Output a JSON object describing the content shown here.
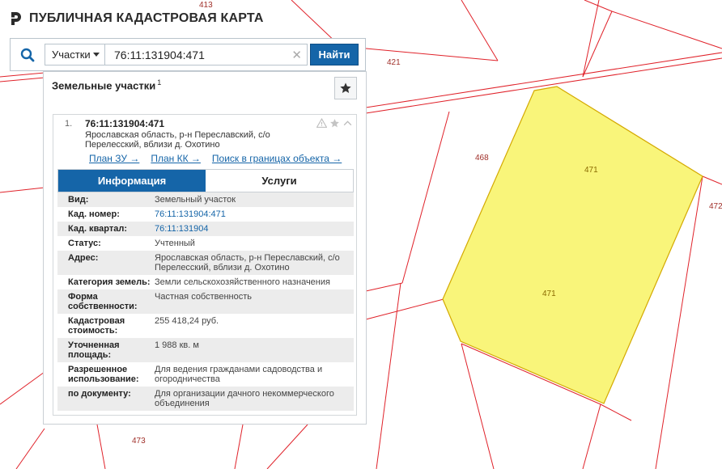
{
  "app": {
    "title": "ПУБЛИЧНАЯ КАДАСТРОВАЯ КАРТА",
    "logo_icon": "pkk-logo-icon"
  },
  "search": {
    "icon": "search-icon",
    "type_selected": "Участки",
    "query": "76:11:131904:471",
    "clear_symbol": "✕",
    "find_label": "Найти"
  },
  "map": {
    "labels": {
      "l413": "413",
      "l421": "421",
      "l468": "468",
      "l472": "472",
      "l473": "473"
    },
    "parcel_labels": {
      "p1": "471",
      "p2": "471"
    },
    "parcel_fill": "#f9f57a",
    "parcel_stroke": "#d4a900",
    "boundary_color": "#e0222a"
  },
  "panel": {
    "heading": "Земельные участки",
    "count": "1",
    "favorite_icon": "star-icon",
    "result": {
      "index": "1.",
      "cad_number": "76:11:131904:471",
      "address": "Ярославская область, р-н Переславский, с/о Перелесский, вблизи д. Охотино",
      "links": [
        "План ЗУ →",
        "План КК →",
        "Поиск в границах объекта →"
      ],
      "tabs": {
        "info": "Информация",
        "services": "Услуги"
      },
      "attributes": [
        {
          "key": "Вид:",
          "value": "Земельный участок"
        },
        {
          "key": "Кад. номер:",
          "value": "76:11:131904:471",
          "link": true
        },
        {
          "key": "Кад. квартал:",
          "value": "76:11:131904",
          "link": true
        },
        {
          "key": "Статус:",
          "value": "Учтенный"
        },
        {
          "key": "Адрес:",
          "value": "Ярославская область, р-н Переславский, с/о Перелесский, вблизи д. Охотино"
        },
        {
          "key": "Категория земель:",
          "value": "Земли сельскохозяйственного назначения"
        },
        {
          "key": "Форма собственности:",
          "value": "Частная собственность"
        },
        {
          "key": "Кадастровая стоимость:",
          "value": "255 418,24 руб."
        },
        {
          "key": "Уточненная площадь:",
          "value": "1 988 кв. м"
        },
        {
          "key": "Разрешенное использование:",
          "value": "Для ведения гражданами садоводства и огородничества"
        },
        {
          "key": "по документу:",
          "value": "Для организации дачного некоммерческого объединения"
        }
      ]
    }
  }
}
